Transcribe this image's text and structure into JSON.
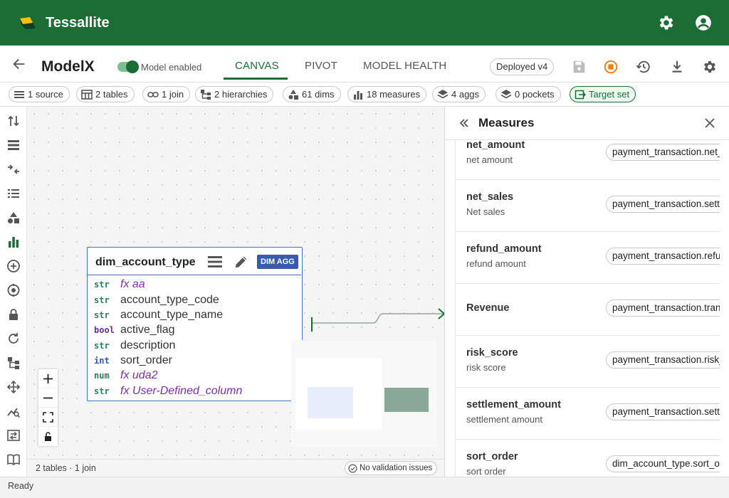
{
  "app": {
    "name": "Tessallite"
  },
  "model": {
    "name": "ModelX",
    "enabled_label": "Model enabled",
    "enabled": true,
    "deployed_label": "Deployed v4"
  },
  "tabs": [
    {
      "label": "CANVAS",
      "active": true
    },
    {
      "label": "PIVOT",
      "active": false
    },
    {
      "label": "MODEL HEALTH",
      "active": false
    }
  ],
  "summary_chips": [
    {
      "label": "1 source",
      "icon": "list-icon"
    },
    {
      "label": "2 tables",
      "icon": "table-icon"
    },
    {
      "label": "1 join",
      "icon": "link-icon"
    },
    {
      "label": "2 hierarchies",
      "icon": "hierarchy-icon"
    },
    {
      "label": "61 dims",
      "icon": "shapes-icon"
    },
    {
      "label": "18 measures",
      "icon": "bar-chart-icon"
    },
    {
      "label": "4 aggs",
      "icon": "layers-icon"
    },
    {
      "label": "0 pockets",
      "icon": "layers-icon"
    },
    {
      "label": "Target set",
      "icon": "target-icon"
    }
  ],
  "table_card": {
    "title": "dim_account_type",
    "badge": "DIM AGG",
    "columns": [
      {
        "type": "str",
        "name": "fx aa",
        "fx": true
      },
      {
        "type": "str",
        "name": "account_type_code",
        "fx": false
      },
      {
        "type": "str",
        "name": "account_type_name",
        "fx": false
      },
      {
        "type": "bool",
        "name": "active_flag",
        "fx": false
      },
      {
        "type": "str",
        "name": "description",
        "fx": false
      },
      {
        "type": "int",
        "name": "sort_order",
        "fx": false
      },
      {
        "type": "num",
        "name": "fx uda2",
        "fx": true
      },
      {
        "type": "str",
        "name": "fx User-Defined_column",
        "fx": true
      }
    ]
  },
  "canvas_footer": {
    "stats": "2 tables · 1 join",
    "validation": "No validation issues"
  },
  "panel": {
    "title": "Measures",
    "measures": [
      {
        "name": "net_amount",
        "description": "net amount",
        "expression": "payment_transaction.net_amount"
      },
      {
        "name": "net_sales",
        "description": "Net sales",
        "expression": "payment_transaction.settlement_amount"
      },
      {
        "name": "refund_amount",
        "description": "refund amount",
        "expression": "payment_transaction.refund_amount"
      },
      {
        "name": "Revenue",
        "description": "",
        "expression": "payment_transaction.transaction_amount"
      },
      {
        "name": "risk_score",
        "description": "risk score",
        "expression": "payment_transaction.risk_score"
      },
      {
        "name": "settlement_amount",
        "description": "settlement amount",
        "expression": "payment_transaction.settlement_amount"
      },
      {
        "name": "sort_order",
        "description": "sort order",
        "expression": "dim_account_type.sort_order"
      }
    ]
  },
  "status": {
    "text": "Ready"
  },
  "colors": {
    "brand": "#1b6d35",
    "table_border": "#4a6cc9",
    "badge": "#3a5aad",
    "fx_text": "#7b2fa8",
    "stop_orange": "#f57c00"
  }
}
